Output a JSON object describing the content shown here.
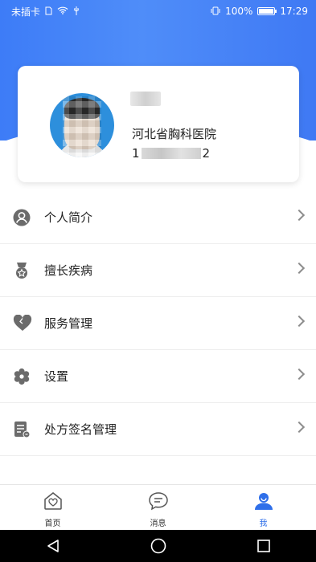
{
  "status_bar": {
    "carrier": "未插卡",
    "battery_percent": "100%",
    "time": "17:29"
  },
  "profile": {
    "name": "",
    "hospital": "河北省胸科医院",
    "phone_prefix": "1",
    "phone_suffix": "2"
  },
  "menu": {
    "items": [
      {
        "label": "个人简介",
        "icon": "person-icon"
      },
      {
        "label": "擅长疾病",
        "icon": "medal-icon"
      },
      {
        "label": "服务管理",
        "icon": "heart-icon"
      },
      {
        "label": "设置",
        "icon": "gear-icon"
      },
      {
        "label": "处方签名管理",
        "icon": "prescription-icon"
      }
    ]
  },
  "tabbar": {
    "tabs": [
      {
        "label": "首页",
        "icon": "home-icon"
      },
      {
        "label": "消息",
        "icon": "message-icon"
      },
      {
        "label": "我",
        "icon": "user-icon"
      }
    ],
    "active_index": 2
  },
  "colors": {
    "primary": "#3f7cf5",
    "icon_gray": "#666666",
    "active_tab": "#2f6fe9"
  }
}
